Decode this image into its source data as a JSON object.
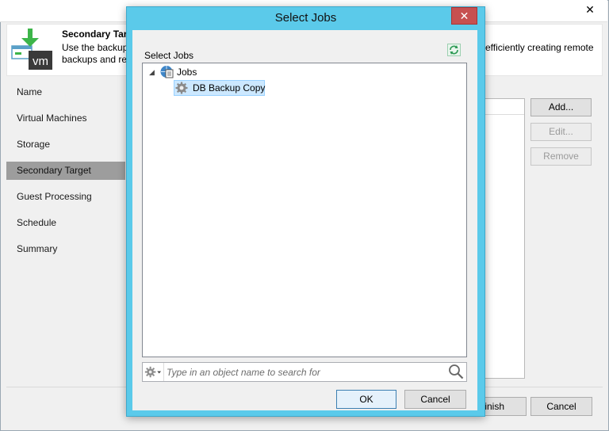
{
  "wizard": {
    "close_glyph": "✕",
    "header": {
      "title": "Secondary Targ",
      "desc_line1": "Use the backup",
      "desc_line2": "backups and re",
      "desc_right": "efficiently creating remote"
    },
    "nav": [
      {
        "label": "Name"
      },
      {
        "label": "Virtual Machines"
      },
      {
        "label": "Storage"
      },
      {
        "label": "Secondary Target",
        "selected": true
      },
      {
        "label": "Guest Processing"
      },
      {
        "label": "Schedule"
      },
      {
        "label": "Summary"
      }
    ],
    "buttons": {
      "add": "Add...",
      "edit": "Edit...",
      "remove": "Remove",
      "finish": "Finish",
      "cancel": "Cancel"
    }
  },
  "dialog": {
    "title": "Select Jobs",
    "close_glyph": "✕",
    "section_label": "Select Jobs",
    "tree": {
      "root": {
        "label": "Jobs",
        "expanded": true,
        "icon": "jobs-icon"
      },
      "children": [
        {
          "label": "DB Backup Copy",
          "selected": true,
          "icon": "gear-icon"
        }
      ]
    },
    "search": {
      "placeholder": "Type in an object name to search for",
      "value": ""
    },
    "ok": "OK",
    "cancel": "Cancel"
  },
  "colors": {
    "dialog_frame": "#5bcaea",
    "close_button": "#c75050",
    "selection": "#cce8ff",
    "nav_selected": "#9d9d9d",
    "icon_green": "#3db54a"
  }
}
